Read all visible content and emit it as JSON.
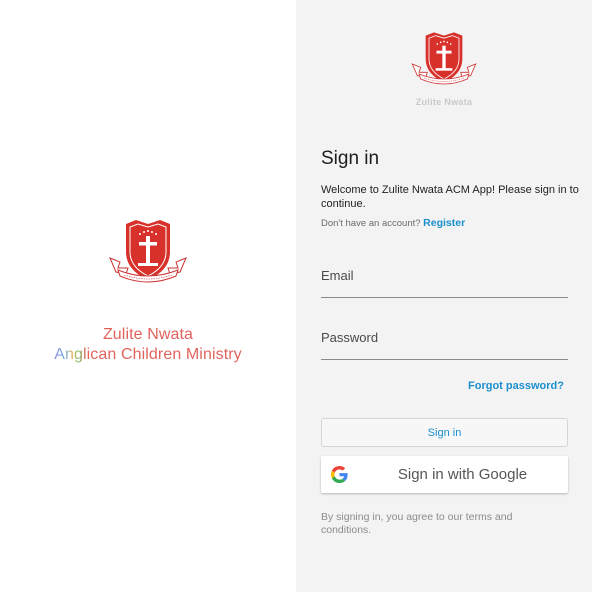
{
  "splash": {
    "line1": "Zulite Nwata",
    "line2": "Anglican Children Ministry",
    "logo_icon": "acm-crest-logo"
  },
  "panel": {
    "logo_icon": "acm-crest-logo",
    "brand_name": "Zulite Nwata",
    "heading": "Sign in",
    "welcome": "Welcome to Zulite Nwata ACM App! Please sign in to continue.",
    "no_account": "Don't have an account?",
    "register": "Register",
    "email_placeholder": "Email",
    "password_placeholder": "Password",
    "forgot": "Forgot password?",
    "signin_button": "Sign in",
    "google_button": "Sign in with Google",
    "google_icon": "google-g-icon",
    "terms": "By signing in, you agree to our terms and conditions."
  },
  "colors": {
    "accent": "#1a8fce",
    "brand_red": "#e0625a",
    "panel_bg": "#f3f3f3"
  }
}
